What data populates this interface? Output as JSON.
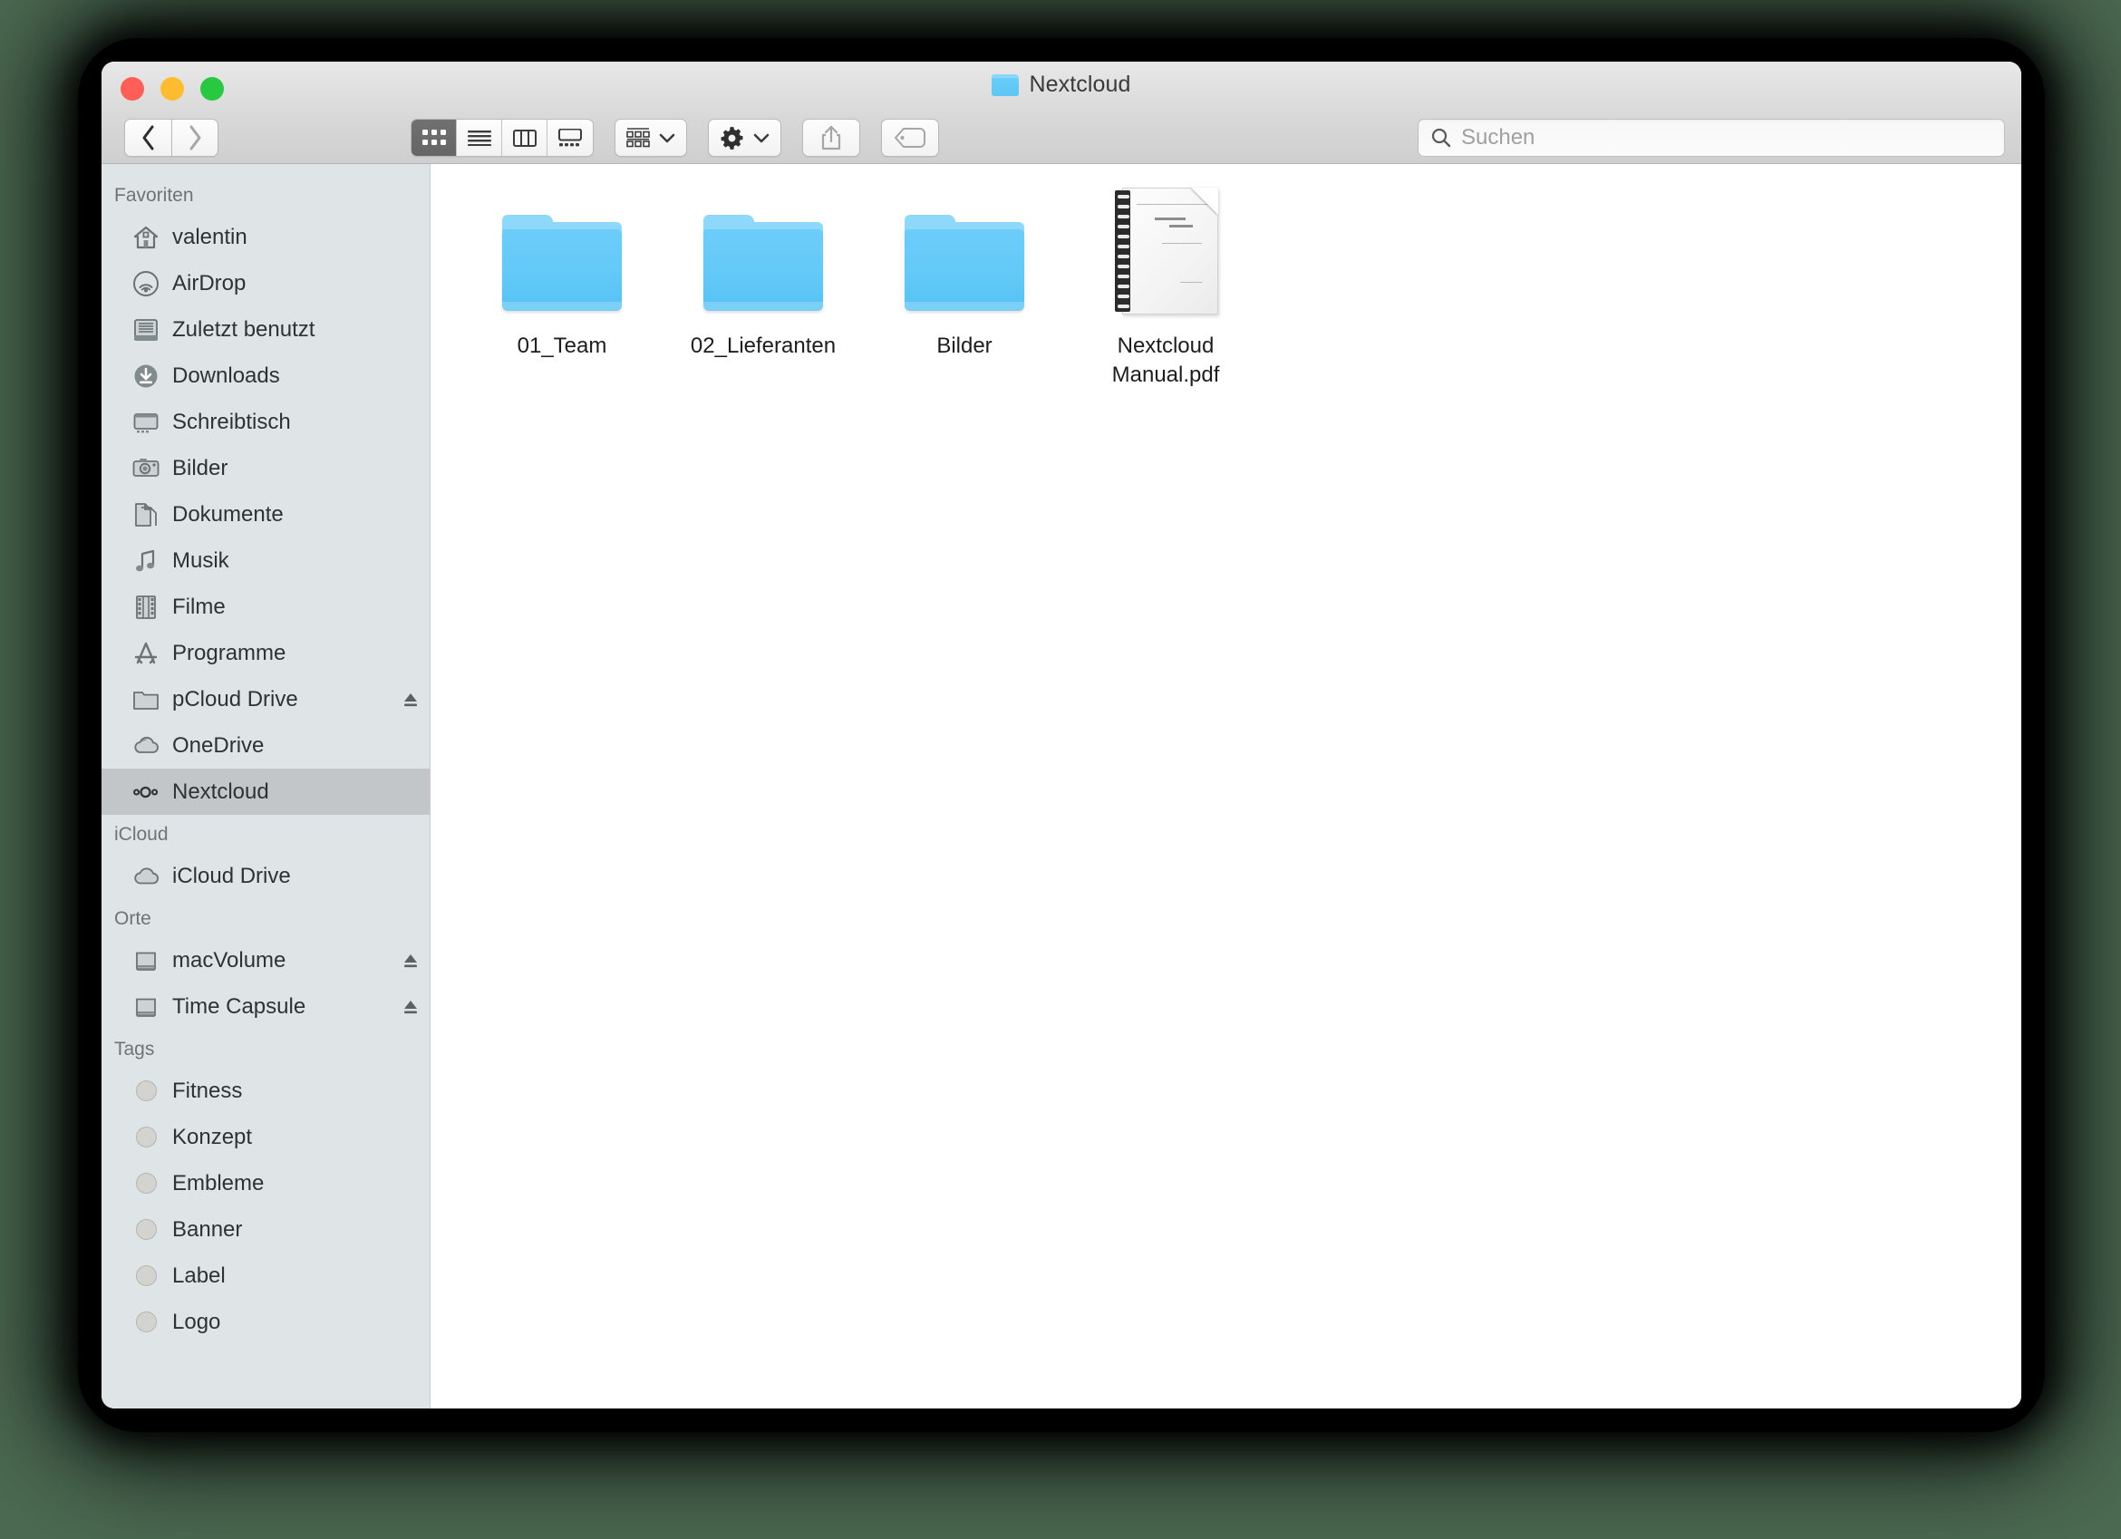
{
  "window": {
    "title": "Nextcloud",
    "title_icon": "folder-icon",
    "traffic_lights": [
      {
        "name": "close",
        "color": "#ff5f57"
      },
      {
        "name": "minimize",
        "color": "#febc2e"
      },
      {
        "name": "zoom",
        "color": "#28c840"
      }
    ]
  },
  "toolbar": {
    "back": "‹",
    "forward": "›",
    "view_modes": [
      {
        "name": "icon-view",
        "active": true
      },
      {
        "name": "list-view",
        "active": false
      },
      {
        "name": "column-view",
        "active": false
      },
      {
        "name": "gallery-view",
        "active": false
      }
    ],
    "arrange_button": "arrange-icon",
    "action_button": "gear-icon",
    "share_button": "share-icon",
    "tags_button": "tag-icon"
  },
  "search": {
    "placeholder": "Suchen",
    "value": "",
    "icon": "search-icon"
  },
  "sidebar": {
    "sections": [
      {
        "title": "Favoriten",
        "items": [
          {
            "label": "valentin",
            "icon": "home-icon",
            "eject": false,
            "selected": false
          },
          {
            "label": "AirDrop",
            "icon": "airdrop-icon",
            "eject": false,
            "selected": false
          },
          {
            "label": "Zuletzt benutzt",
            "icon": "recents-icon",
            "eject": false,
            "selected": false
          },
          {
            "label": "Downloads",
            "icon": "downloads-icon",
            "eject": false,
            "selected": false
          },
          {
            "label": "Schreibtisch",
            "icon": "desktop-icon",
            "eject": false,
            "selected": false
          },
          {
            "label": "Bilder",
            "icon": "camera-icon",
            "eject": false,
            "selected": false
          },
          {
            "label": "Dokumente",
            "icon": "documents-icon",
            "eject": false,
            "selected": false
          },
          {
            "label": "Musik",
            "icon": "music-icon",
            "eject": false,
            "selected": false
          },
          {
            "label": "Filme",
            "icon": "film-icon",
            "eject": false,
            "selected": false
          },
          {
            "label": "Programme",
            "icon": "appstore-icon",
            "eject": false,
            "selected": false
          },
          {
            "label": "pCloud Drive",
            "icon": "folder-icon",
            "eject": true,
            "selected": false
          },
          {
            "label": "OneDrive",
            "icon": "cloud-icon",
            "eject": false,
            "selected": false
          },
          {
            "label": "Nextcloud",
            "icon": "nextcloud-icon",
            "eject": false,
            "selected": true
          }
        ]
      },
      {
        "title": "iCloud",
        "items": [
          {
            "label": "iCloud Drive",
            "icon": "icloud-icon",
            "eject": false,
            "selected": false
          }
        ]
      },
      {
        "title": "Orte",
        "items": [
          {
            "label": "macVolume",
            "icon": "drive-icon",
            "eject": true,
            "selected": false
          },
          {
            "label": "Time Capsule",
            "icon": "drive-icon",
            "eject": true,
            "selected": false
          }
        ]
      },
      {
        "title": "Tags",
        "items": [
          {
            "label": "Fitness",
            "icon": "tag-dot-icon",
            "dot_color": "#d3d3d0",
            "eject": false,
            "selected": false
          },
          {
            "label": "Konzept",
            "icon": "tag-dot-icon",
            "dot_color": "#d3d3d0",
            "eject": false,
            "selected": false
          },
          {
            "label": "Embleme",
            "icon": "tag-dot-icon",
            "dot_color": "#d3d3d0",
            "eject": false,
            "selected": false
          },
          {
            "label": "Banner",
            "icon": "tag-dot-icon",
            "dot_color": "#d3d3d0",
            "eject": false,
            "selected": false
          },
          {
            "label": "Label",
            "icon": "tag-dot-icon",
            "dot_color": "#d3d3d0",
            "eject": false,
            "selected": false
          },
          {
            "label": "Logo",
            "icon": "tag-dot-icon",
            "dot_color": "#d3d3d0",
            "eject": false,
            "selected": false
          }
        ]
      }
    ]
  },
  "content": {
    "files": [
      {
        "name": "01_Team",
        "kind": "folder"
      },
      {
        "name": "02_Lieferanten",
        "kind": "folder"
      },
      {
        "name": "Bilder",
        "kind": "folder"
      },
      {
        "name": "Nextcloud Manual.pdf",
        "kind": "pdf"
      }
    ]
  },
  "colors": {
    "backdrop": "#4c6a52",
    "sidebar_bg": "#dfe5e7",
    "sidebar_selected": "#c2c6c8",
    "content_bg": "#ffffff",
    "folder_blue": "#63c9f7",
    "toolbar_bg": "#d8d8d8"
  }
}
